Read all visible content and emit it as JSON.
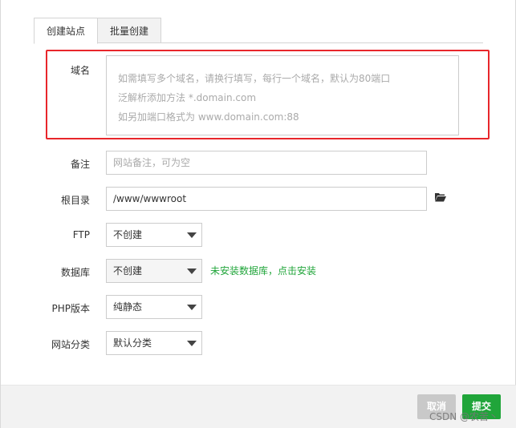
{
  "tabs": [
    {
      "label": "创建站点",
      "active": true
    },
    {
      "label": "批量创建",
      "active": false
    }
  ],
  "domain": {
    "label": "域名",
    "placeholder_lines": [
      "如需填写多个域名，请换行填写，每行一个域名，默认为80端口",
      "泛解析添加方法 *.domain.com",
      "如另加端口格式为 www.domain.com:88"
    ]
  },
  "remark": {
    "label": "备注",
    "placeholder": "网站备注，可为空"
  },
  "root_dir": {
    "label": "根目录",
    "value": "/www/wwwroot"
  },
  "ftp": {
    "label": "FTP",
    "selected": "不创建"
  },
  "database": {
    "label": "数据库",
    "selected": "不创建",
    "hint": "未安装数据库，点击安装"
  },
  "php": {
    "label": "PHP版本",
    "selected": "纯静态"
  },
  "category": {
    "label": "网站分类",
    "selected": "默认分类"
  },
  "footer": {
    "cancel_label": "取消",
    "submit_label": "提交"
  },
  "watermark": "CSDN @农苦丶",
  "colors": {
    "accent": "#20a53a",
    "highlight": "#e8262b"
  }
}
